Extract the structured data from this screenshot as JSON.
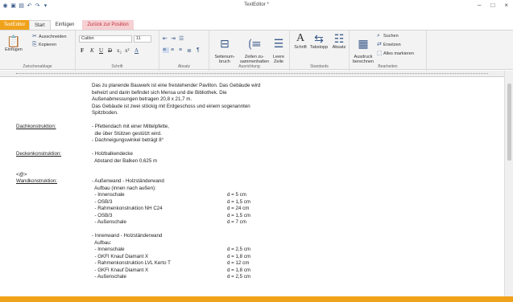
{
  "window": {
    "title": "TextEditor *",
    "qat_icons": [
      "app-icon",
      "save-icon",
      "save-all-icon",
      "undo-icon",
      "redo-icon",
      "qat-menu-icon"
    ],
    "controls": {
      "minimize": "–",
      "maximize": "□",
      "close": "×"
    }
  },
  "tabs": [
    {
      "label": "TextEditor"
    },
    {
      "label": "Start"
    },
    {
      "label": "Einfügen"
    },
    {
      "label": "Zurück zur Position"
    }
  ],
  "ribbon": {
    "clipboard": {
      "paste": "Einfügen",
      "cut": "Ausschneiden",
      "copy": "Kopieren",
      "label": "Zwischenablage"
    },
    "font": {
      "font_name": "Calibri",
      "font_size": "11",
      "label": "Schrift",
      "bold": "F",
      "italic": "K",
      "underline": "U",
      "strike": "D",
      "subscript": "x₂",
      "superscript": "x²",
      "clear": "A"
    },
    "paragraph": {
      "label": "Absatz"
    },
    "alignment": {
      "page_break": "Seitenum-\nbruch",
      "keep_lines": "Zeilen zu-\nsammenhalten",
      "empty_line": "Leere\nZeile",
      "label": "Ausrichtung"
    },
    "standards": {
      "font": "Schrift",
      "tabstop": "Tabstopp",
      "paragraph": "Absatz",
      "label": "Standards"
    },
    "edit": {
      "calc": "Ausdruck\nberechnen",
      "search": "Suchen",
      "replace": "Ersetzen",
      "select_all": "Alles markieren",
      "label": "Bearbeiten"
    }
  },
  "document": {
    "lines": [
      {
        "left": "",
        "right": "Das zu planende Bauwerk ist eine freistehender Pavillon. Das Gebäude wird",
        "val": ""
      },
      {
        "left": "",
        "right": "beheizt und darin befindet sich Mensa und die Bibliothek. Die",
        "val": ""
      },
      {
        "left": "",
        "right": "Außenabmessungen betragen 20,8 x 21,7 m.",
        "val": ""
      },
      {
        "left": "",
        "right": "Das Gebäude ist zwei stöckig mit Erdgeschoss und einem sogenannten",
        "val": ""
      },
      {
        "left": "",
        "right": "Spitzboden.",
        "val": ""
      },
      {
        "left": "",
        "right": "",
        "val": ""
      },
      {
        "left": "Dachkonstruktion:",
        "right": "- Pfettendach mit einer Mittelpfette,",
        "val": ""
      },
      {
        "left": "",
        "right": "  die über Stützen gestützt wird.",
        "val": ""
      },
      {
        "left": "",
        "right": "- Dachneigungswinkel beträgt 8°",
        "val": ""
      },
      {
        "left": "",
        "right": "",
        "val": ""
      },
      {
        "left": "Deckenkonstruktion:",
        "right": "- Holzbalkendecke",
        "val": ""
      },
      {
        "left": "",
        "right": "  Abstand der Balken 0,625 m",
        "val": ""
      },
      {
        "left": "",
        "right": "",
        "val": ""
      },
      {
        "left": "<@>",
        "right": "",
        "val": ""
      },
      {
        "left": "Wandkonstruktion:",
        "right": "- Außenwand - Holzständerwand",
        "val": ""
      },
      {
        "left": "",
        "right": "  Aufbau (innen nach außen):",
        "val": ""
      },
      {
        "left": "",
        "right": "  - Innenschale",
        "val": "d = 5 cm"
      },
      {
        "left": "",
        "right": "  - OSB/3",
        "val": "d = 1,5 cm"
      },
      {
        "left": "",
        "right": "  - Rahmenkonstruktion NH C24",
        "val": "d = 24 cm"
      },
      {
        "left": "",
        "right": "  - OSB/3",
        "val": "d = 1,5 cm"
      },
      {
        "left": "",
        "right": "  - Außenschale",
        "val": "d = 7 cm"
      },
      {
        "left": "",
        "right": "",
        "val": ""
      },
      {
        "left": "",
        "right": "- Innenwand - Holzständerwand",
        "val": ""
      },
      {
        "left": "",
        "right": "  Aufbau:",
        "val": ""
      },
      {
        "left": "",
        "right": "  - Innenschale",
        "val": "d = 2,5 cm"
      },
      {
        "left": "",
        "right": "  - GKFI Knauf Diamant X",
        "val": "d = 1,8 cm"
      },
      {
        "left": "",
        "right": "  - Rahmenkonstruktion LVL Kerto T",
        "val": "d = 12 cm"
      },
      {
        "left": "",
        "right": "  - GKFI Knauf Diamant X",
        "val": "d = 1,8 cm"
      },
      {
        "left": "",
        "right": "  - Außenschale",
        "val": "d = 2,5 cm"
      }
    ]
  },
  "colors": {
    "accent": "#f0a21a",
    "context_tab": "#f6d0d3",
    "icon_blue": "#3a5a8a"
  }
}
